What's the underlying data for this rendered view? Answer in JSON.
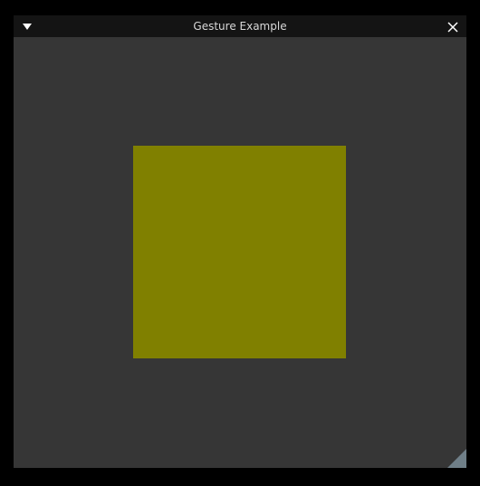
{
  "window": {
    "title": "Gesture Example",
    "icons": {
      "collapse": "triangle-down-icon",
      "close": "close-icon",
      "resize": "resize-grip-icon"
    }
  },
  "content": {
    "square_color": "#808000"
  }
}
